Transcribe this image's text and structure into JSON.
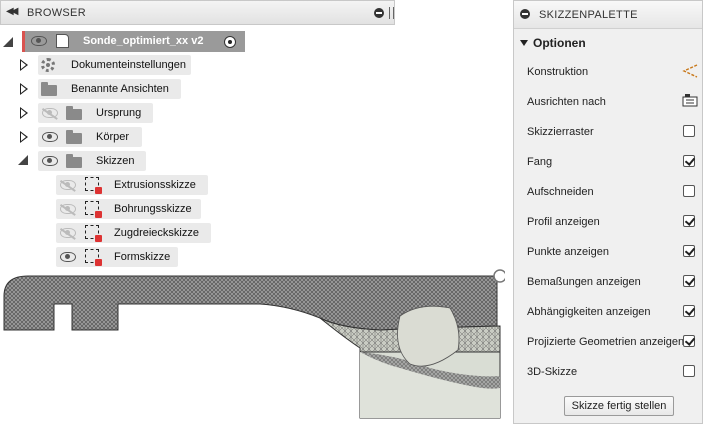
{
  "browser": {
    "title": "BROWSER",
    "root_label": "Sonde_optimiert_xx v2",
    "items": [
      {
        "label": "Dokumenteinstellungen",
        "icon": "gear-icon"
      },
      {
        "label": "Benannte Ansichten",
        "icon": "folder-icon"
      },
      {
        "label": "Ursprung",
        "icon": "folder-icon",
        "visible": false
      },
      {
        "label": "Körper",
        "icon": "folder-icon",
        "visible": true
      },
      {
        "label": "Skizzen",
        "icon": "folder-icon",
        "visible": true,
        "expanded": true
      }
    ],
    "sketches": [
      {
        "label": "Extrusionsskizze",
        "visible": false
      },
      {
        "label": "Bohrungsskizze",
        "visible": false
      },
      {
        "label": "Zugdreieckskizze",
        "visible": false
      },
      {
        "label": "Formskizze",
        "visible": true
      }
    ]
  },
  "palette": {
    "title": "SKIZZENPALETTE",
    "section": "Optionen",
    "options": [
      {
        "label": "Konstruktion",
        "control": "construction-icon"
      },
      {
        "label": "Ausrichten nach",
        "control": "look-at-icon"
      },
      {
        "label": "Skizzierraster",
        "checked": false
      },
      {
        "label": "Fang",
        "checked": true
      },
      {
        "label": "Aufschneiden",
        "checked": false
      },
      {
        "label": "Profil anzeigen",
        "checked": true
      },
      {
        "label": "Punkte anzeigen",
        "checked": true
      },
      {
        "label": "Bemaßungen anzeigen",
        "checked": true
      },
      {
        "label": "Abhängigkeiten anzeigen",
        "checked": true
      },
      {
        "label": "Projizierte Geometrien anzeigen",
        "checked": true
      },
      {
        "label": "3D-Skizze",
        "checked": false
      }
    ],
    "finish_label": "Skizze fertig stellen"
  },
  "colors": {
    "root_accent": "#d9534f",
    "root_bg": "#9a9a9a",
    "mesh": "#5a5a5a",
    "mesh_fill": "#d9ddd4"
  }
}
